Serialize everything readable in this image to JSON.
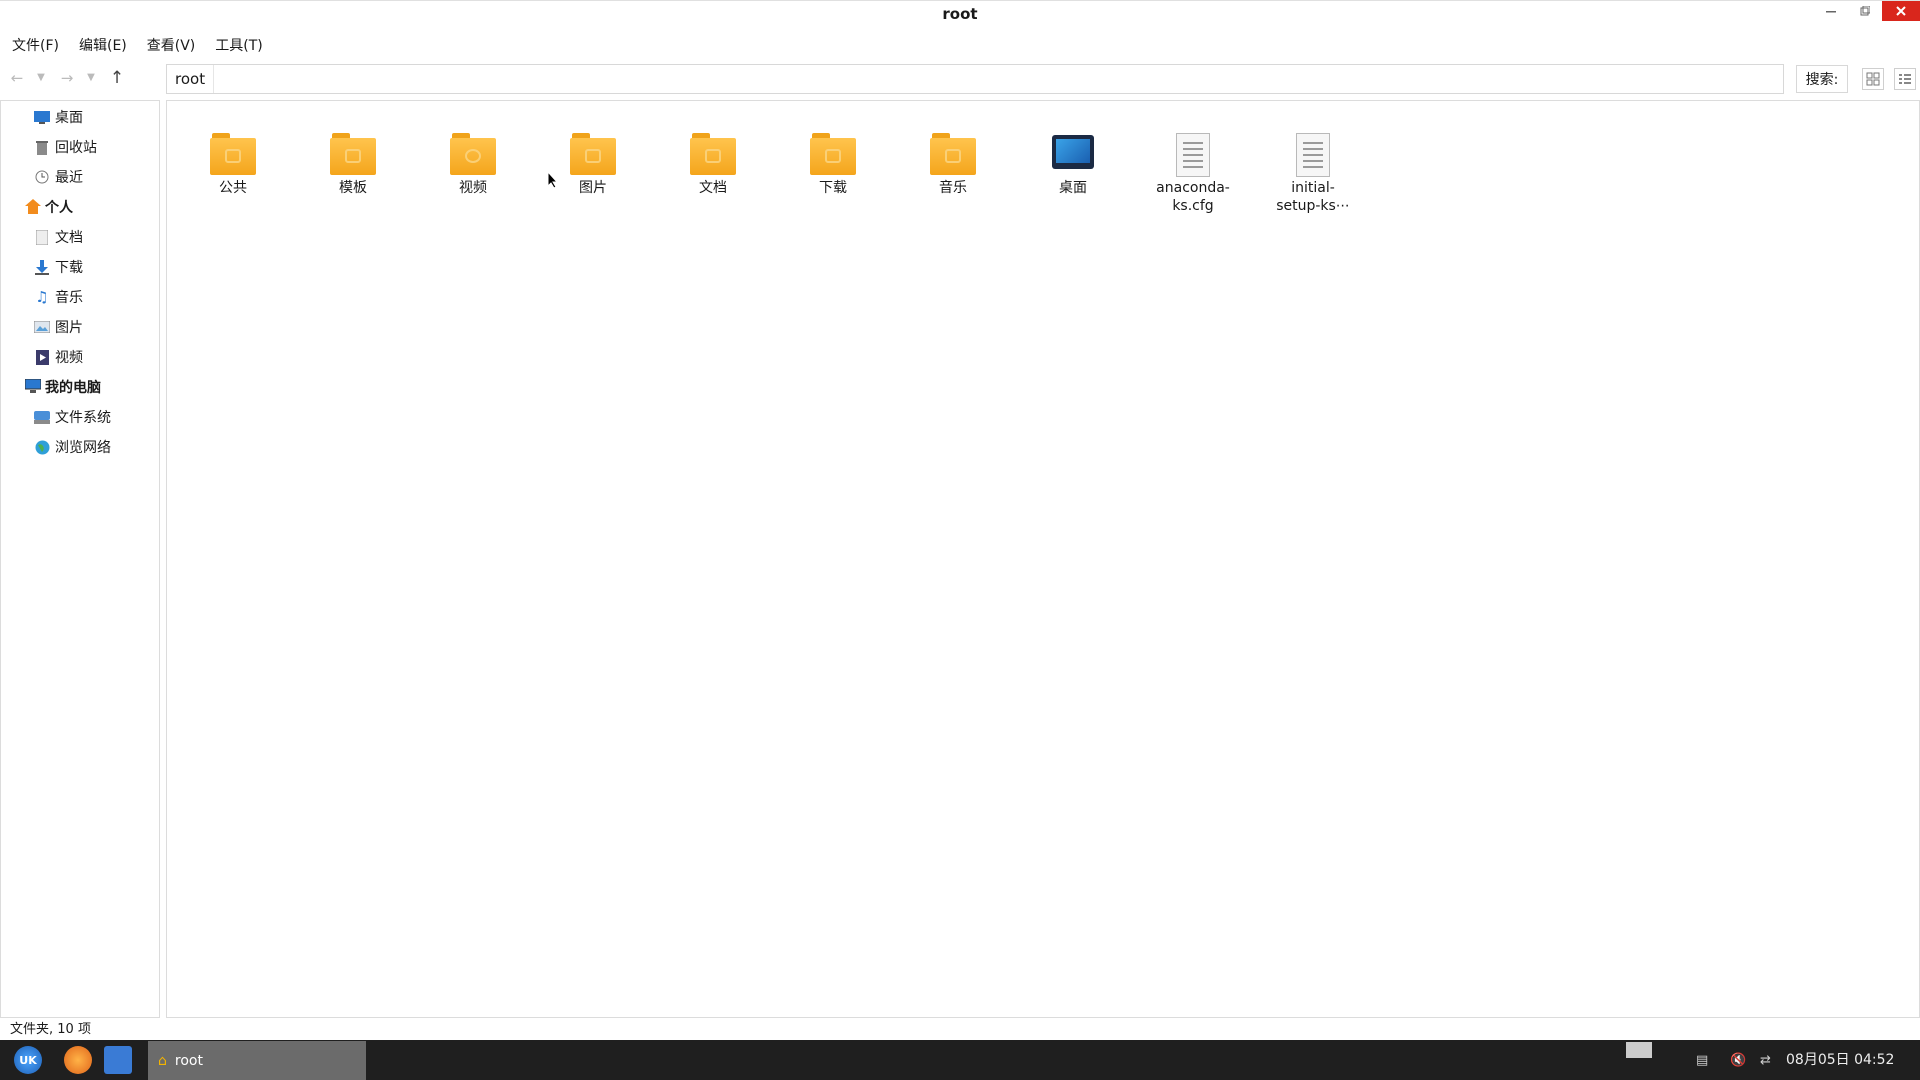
{
  "window": {
    "title": "root"
  },
  "menu": [
    "文件(F)",
    "编辑(E)",
    "查看(V)",
    "工具(T)"
  ],
  "toolbar": {
    "breadcrumb": "root",
    "search_label": "搜索:"
  },
  "sidebar": {
    "top_items": [
      {
        "label": "桌面",
        "icon": "desktop-icon"
      },
      {
        "label": "回收站",
        "icon": "trash-icon"
      },
      {
        "label": "最近",
        "icon": "clock-icon"
      }
    ],
    "personal_header": "个人",
    "personal_items": [
      {
        "label": "文档",
        "icon": "document-icon"
      },
      {
        "label": "下载",
        "icon": "download-icon"
      },
      {
        "label": "音乐",
        "icon": "music-icon"
      },
      {
        "label": "图片",
        "icon": "picture-icon"
      },
      {
        "label": "视频",
        "icon": "video-icon"
      }
    ],
    "computer_header": "我的电脑",
    "computer_items": [
      {
        "label": "文件系统",
        "icon": "drive-icon"
      },
      {
        "label": "浏览网络",
        "icon": "globe-icon"
      }
    ]
  },
  "files": [
    {
      "name": "公共",
      "type": "folder"
    },
    {
      "name": "模板",
      "type": "folder"
    },
    {
      "name": "视频",
      "type": "folder"
    },
    {
      "name": "图片",
      "type": "folder"
    },
    {
      "name": "文档",
      "type": "folder"
    },
    {
      "name": "下载",
      "type": "folder"
    },
    {
      "name": "音乐",
      "type": "folder"
    },
    {
      "name": "桌面",
      "type": "desktop"
    },
    {
      "name_line1": "anaconda-",
      "name_line2": "ks.cfg",
      "type": "doc"
    },
    {
      "name_line1": "initial-",
      "name_line2": "setup-ks⋯",
      "type": "doc"
    }
  ],
  "status": {
    "text": "文件夹, 10 项"
  },
  "taskbar": {
    "task_label": "root",
    "start_label": "UK",
    "clock": "08月05日 04:52"
  },
  "colors": {
    "close_button": "#d9261c",
    "folder": "#f4a51c",
    "taskbar": "#1f1f1f"
  }
}
